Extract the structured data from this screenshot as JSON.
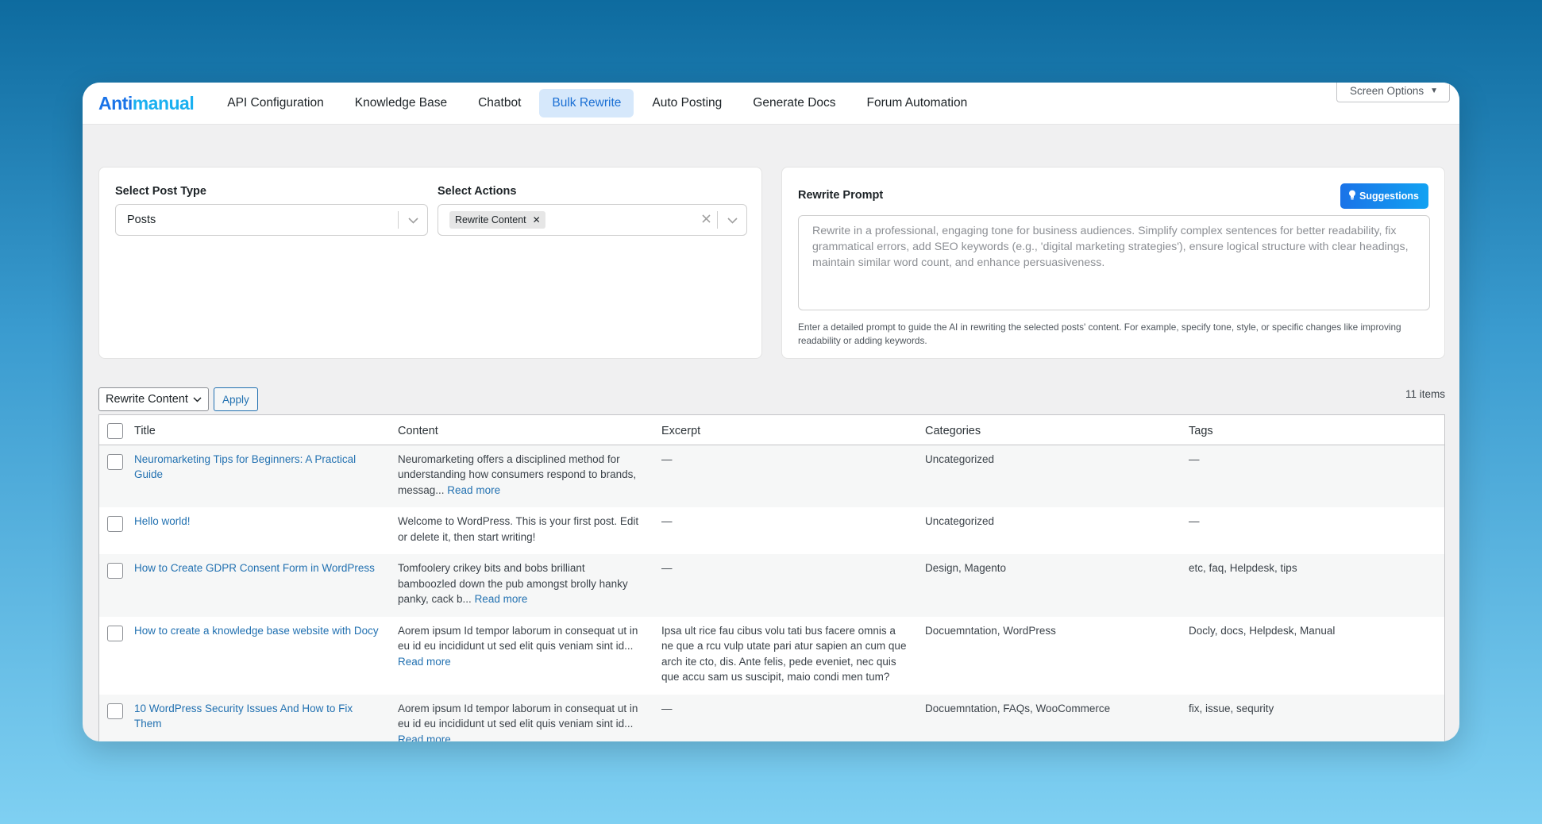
{
  "brand": {
    "part1": "Anti",
    "part2": "manual"
  },
  "nav": {
    "tabs": [
      {
        "label": "API Configuration"
      },
      {
        "label": "Knowledge Base"
      },
      {
        "label": "Chatbot"
      },
      {
        "label": "Bulk Rewrite",
        "active": true
      },
      {
        "label": "Auto Posting"
      },
      {
        "label": "Generate Docs"
      },
      {
        "label": "Forum Automation"
      }
    ],
    "screen_options": "Screen Options"
  },
  "filters": {
    "post_type_label": "Select Post Type",
    "post_type_value": "Posts",
    "actions_label": "Select Actions",
    "actions_chip": "Rewrite Content"
  },
  "prompt": {
    "title": "Rewrite Prompt",
    "suggestions_label": "Suggestions",
    "placeholder": "Rewrite in a professional, engaging tone for business audiences. Simplify complex sentences for better readability, fix grammatical errors, add SEO keywords (e.g., 'digital marketing strategies'), ensure logical structure with clear headings, maintain similar word count, and enhance persuasiveness.",
    "help": "Enter a detailed prompt to guide the AI in rewriting the selected posts' content. For example, specify tone, style, or specific changes like improving readability or adding keywords."
  },
  "bulk": {
    "select_value": "Rewrite Content",
    "apply_label": "Apply",
    "items_count": "11 items"
  },
  "table": {
    "columns": {
      "title": "Title",
      "content": "Content",
      "excerpt": "Excerpt",
      "categories": "Categories",
      "tags": "Tags"
    },
    "read_more": "Read more",
    "rows": [
      {
        "title": "Neuromarketing Tips for Beginners: A Practical Guide",
        "content": "Neuromarketing offers a disciplined method for understanding how consumers respond to brands, messag...",
        "excerpt": "—",
        "categories": "Uncategorized",
        "tags": "—"
      },
      {
        "title": "Hello world!",
        "content": "Welcome to WordPress. This is your first post. Edit or delete it, then start writing!",
        "excerpt": "—",
        "categories": "Uncategorized",
        "tags": "—"
      },
      {
        "title": "How to Create GDPR Consent Form in WordPress",
        "content": "Tomfoolery crikey bits and bobs brilliant bamboozled down the pub amongst brolly hanky panky, cack b...",
        "excerpt": "—",
        "categories": "Design, Magento",
        "tags": "etc, faq, Helpdesk, tips"
      },
      {
        "title": "How to create a knowledge base website with Docy",
        "content": "Aorem ipsum Id tempor laborum in consequat ut in eu id eu incididunt ut sed elit quis veniam sint id...",
        "excerpt": "Ipsa ult rice fau cibus volu tati bus facere omnis a ne que a rcu vulp utate pari atur sapien an cum que arch ite cto, dis. Ante felis, pede eveniet, nec quis que accu sam us suscipit, maio condi men tum?",
        "categories": "Docuemntation, WordPress",
        "tags": "Docly, docs, Helpdesk, Manual"
      },
      {
        "title": "10 WordPress Security Issues And How to Fix Them",
        "content": "Aorem ipsum Id tempor laborum in consequat ut in eu id eu incididunt ut sed elit quis veniam sint id...",
        "excerpt": "—",
        "categories": "Docuemntation, FAQs, WooCommerce",
        "tags": "fix, issue, sequrity"
      }
    ]
  }
}
